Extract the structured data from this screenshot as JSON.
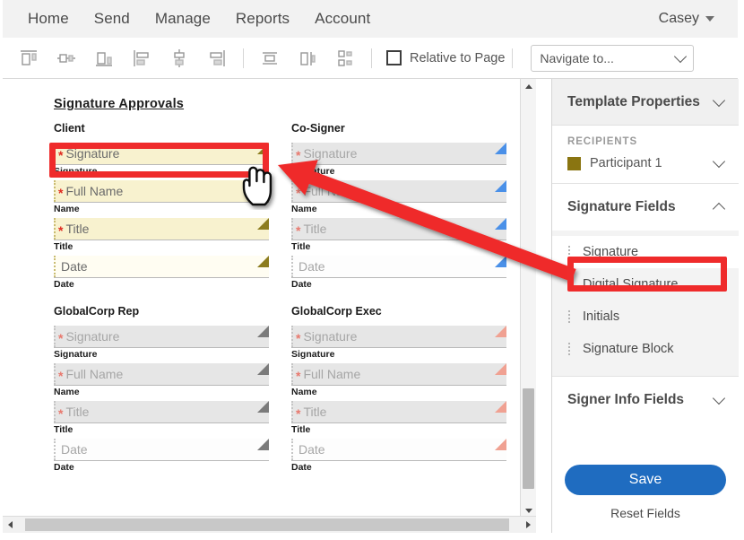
{
  "topnav": {
    "items": [
      {
        "label": "Home",
        "name": "nav-home"
      },
      {
        "label": "Send",
        "name": "nav-send"
      },
      {
        "label": "Manage",
        "name": "nav-manage"
      },
      {
        "label": "Reports",
        "name": "nav-reports"
      },
      {
        "label": "Account",
        "name": "nav-account"
      }
    ],
    "user": "Casey"
  },
  "toolbar": {
    "align_icons": [
      "align-top-icon",
      "align-middle-horizontal-icon",
      "align-bottom-icon",
      "align-left-icon",
      "align-center-icon",
      "align-right-icon",
      "distribute-horizontal-icon",
      "distribute-vertical-icon",
      "match-size-icon"
    ],
    "relative_to_page_label": "Relative to Page",
    "relative_to_page_checked": false,
    "navigate_to_value": "Navigate to..."
  },
  "document": {
    "title": "Signature Approvals",
    "columns": [
      {
        "name": "client",
        "theme": "t-client",
        "title": "Client",
        "fields": [
          {
            "text": "Signature",
            "required": true,
            "label": "Signature",
            "kind": "signature"
          },
          {
            "text": "Full Name",
            "required": true,
            "label": "Name",
            "kind": "name"
          },
          {
            "text": "Title",
            "required": true,
            "label": "Title",
            "kind": "title"
          },
          {
            "text": "Date",
            "required": false,
            "label": "Date",
            "kind": "date"
          }
        ]
      },
      {
        "name": "co-signer",
        "theme": "t-cosigner",
        "title": "Co-Signer",
        "fields": [
          {
            "text": "Signature",
            "required": true,
            "label": "Signature",
            "kind": "signature"
          },
          {
            "text": "Full Name",
            "required": true,
            "label": "Name",
            "kind": "name"
          },
          {
            "text": "Title",
            "required": true,
            "label": "Title",
            "kind": "title"
          },
          {
            "text": "Date",
            "required": false,
            "label": "Date",
            "kind": "date"
          }
        ]
      },
      {
        "name": "globalcorp-rep",
        "theme": "t-rep",
        "title": "GlobalCorp Rep",
        "fields": [
          {
            "text": "Signature",
            "required": true,
            "label": "Signature",
            "kind": "signature"
          },
          {
            "text": "Full Name",
            "required": true,
            "label": "Name",
            "kind": "name"
          },
          {
            "text": "Title",
            "required": true,
            "label": "Title",
            "kind": "title"
          },
          {
            "text": "Date",
            "required": false,
            "label": "Date",
            "kind": "date"
          }
        ]
      },
      {
        "name": "globalcorp-exec",
        "theme": "t-exec",
        "title": "GlobalCorp Exec",
        "fields": [
          {
            "text": "Signature",
            "required": true,
            "label": "Signature",
            "kind": "signature"
          },
          {
            "text": "Full Name",
            "required": true,
            "label": "Name",
            "kind": "name"
          },
          {
            "text": "Title",
            "required": true,
            "label": "Title",
            "kind": "title"
          },
          {
            "text": "Date",
            "required": false,
            "label": "Date",
            "kind": "date"
          }
        ]
      }
    ]
  },
  "panel": {
    "template_properties_label": "Template Properties",
    "recipients_caption": "RECIPIENTS",
    "recipient_name": "Participant 1",
    "recipient_color": "#8a7511",
    "signature_fields_label": "Signature Fields",
    "signature_field_items": [
      "Signature",
      "Digital Signature",
      "Initials",
      "Signature Block"
    ],
    "selected_signature_field": "Signature",
    "signer_info_fields_label": "Signer Info Fields",
    "save_label": "Save",
    "reset_label": "Reset Fields"
  },
  "annotations": {
    "highlight_color": "#ef2b2b",
    "arrow_color": "#ef2b2b"
  }
}
